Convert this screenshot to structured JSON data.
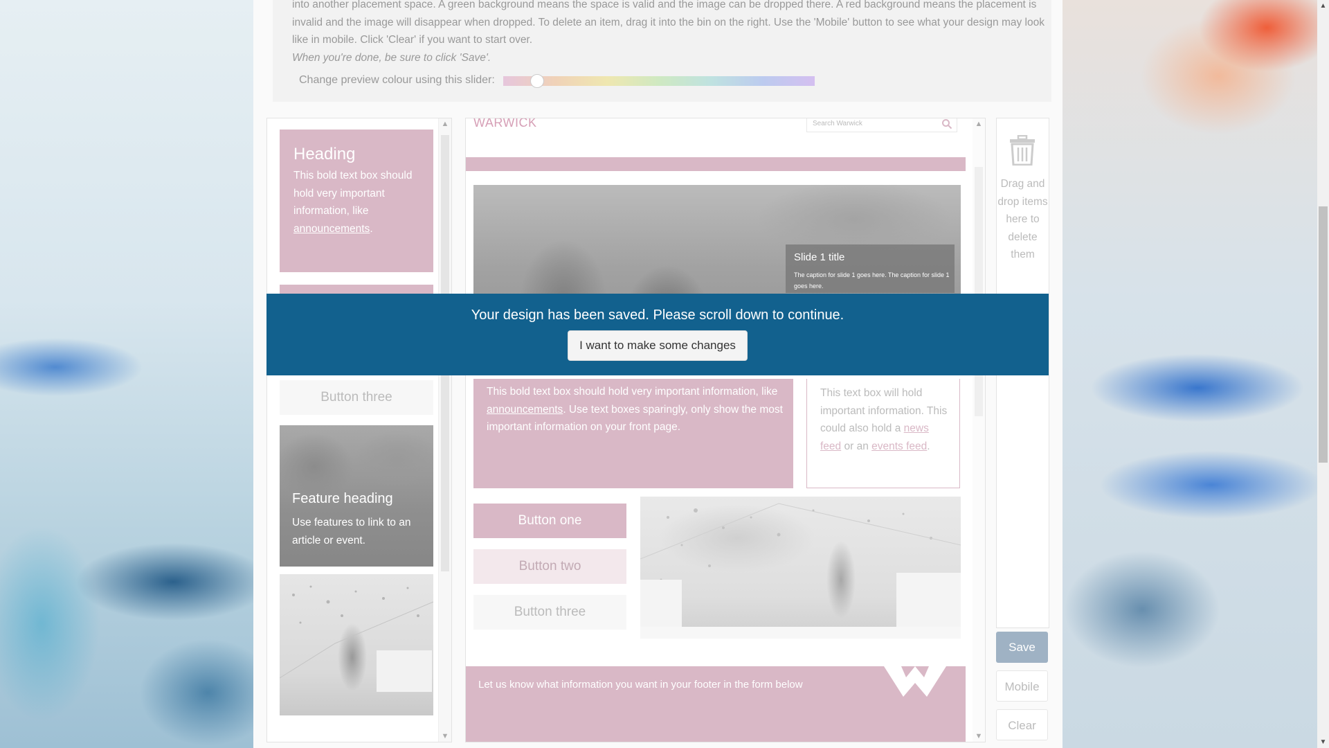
{
  "instructions": {
    "line1": "into another placement space. A green background means the space is valid and the image can be dropped there. A red background means the placement is",
    "line2": "invalid and the image will disappear when dropped. To delete an item, drag it into the bin on the right. Use the 'Mobile' button to see what your design may look",
    "line3": "like in mobile. Click 'Clear' if you want to start over.",
    "italic": "When you're done, be sure to click 'Save'.",
    "slider_label": "Change preview colour using this slider:"
  },
  "palette": {
    "heading_title": "Heading",
    "heading_text": "This bold text box should hold very important information, like",
    "heading_link": "announcements",
    "heading_end": ".",
    "button_three": "Button three",
    "feature_heading": "Feature heading",
    "feature_text": "Use features to link to an article or event."
  },
  "preview": {
    "logo": "WARWICK",
    "search_placeholder": "Search Warwick",
    "slide_title": "Slide 1 title",
    "slide_caption": "The caption for slide 1 goes here. The caption for slide 1 goes here.",
    "bold_text_start": "This bold text box should hold very important information, like",
    "bold_text_link": "announcements",
    "bold_text_end": ". Use text boxes sparingly, only show the most important information on your front page.",
    "text_box_start": "This text box will hold important information. This could also hold a",
    "text_box_link1": "news feed",
    "text_box_mid": "or an",
    "text_box_link2": "events feed",
    "text_box_end": ".",
    "button_one": "Button one",
    "button_two": "Button two",
    "button_three": "Button three",
    "footer_text": "Let us know what information you want in your footer in the form below"
  },
  "bin": {
    "text": "Drag and drop items here to delete them"
  },
  "actions": {
    "save": "Save",
    "mobile": "Mobile",
    "clear": "Clear"
  },
  "banner": {
    "message": "Your design has been saved. Please scroll down to continue.",
    "button": "I want to make some changes"
  },
  "colors": {
    "accent_pink": "#d9b8c6",
    "banner_blue": "#12618e",
    "save_button": "#9fb2c4"
  }
}
